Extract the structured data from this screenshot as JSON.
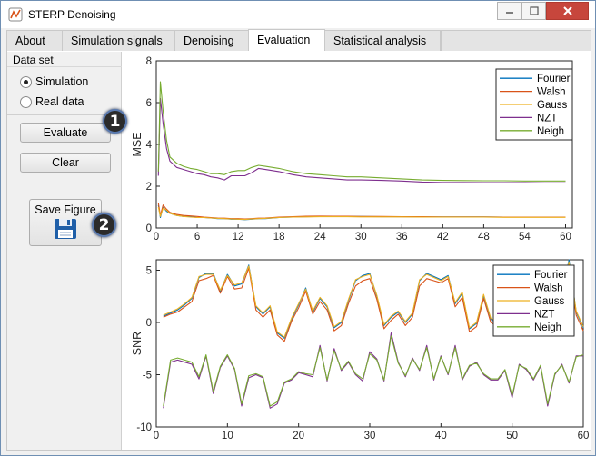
{
  "window": {
    "title": "STERP Denoising"
  },
  "tabs": [
    {
      "label": "About"
    },
    {
      "label": "Simulation signals"
    },
    {
      "label": "Denoising"
    },
    {
      "label": "Evaluation",
      "active": true
    },
    {
      "label": "Statistical analysis"
    }
  ],
  "dataset": {
    "title": "Data set",
    "options": [
      {
        "label": "Simulation",
        "selected": true
      },
      {
        "label": "Real data",
        "selected": false
      }
    ]
  },
  "buttons": {
    "evaluate": "Evaluate",
    "clear": "Clear",
    "save_figure": "Save Figure"
  },
  "badges": [
    "1",
    "2"
  ],
  "icons": [
    "app-icon",
    "minimize-icon",
    "maximize-icon",
    "close-icon",
    "floppy-disk-icon"
  ],
  "colors": {
    "Fourier": "#0072bd",
    "Walsh": "#d95319",
    "Gauss": "#edb120",
    "NZT": "#7e2f8e",
    "Neigh": "#77ac30",
    "badge": "#2b2b2b",
    "close": "#c7463c"
  },
  "chart_data": [
    {
      "type": "line",
      "title": "",
      "xlabel": "",
      "ylabel": "MSE",
      "xlim": [
        0,
        61
      ],
      "ylim": [
        0,
        8
      ],
      "xticks": [
        0,
        6,
        12,
        18,
        24,
        30,
        36,
        42,
        48,
        54,
        60
      ],
      "yticks": [
        0,
        2,
        4,
        6,
        8
      ],
      "legend_position": "top-right",
      "grid": false,
      "x": [
        0.3,
        0.6,
        1,
        1.5,
        2,
        3,
        4,
        5,
        6,
        7,
        8,
        9,
        10,
        11,
        12,
        13,
        14,
        15,
        16,
        18,
        20,
        22,
        24,
        26,
        28,
        30,
        33,
        36,
        39,
        42,
        45,
        48,
        51,
        54,
        57,
        60
      ],
      "series": [
        {
          "name": "Fourier",
          "values": [
            1.1,
            0.5,
            1.0,
            0.8,
            0.7,
            0.6,
            0.55,
            0.55,
            0.5,
            0.5,
            0.48,
            0.45,
            0.45,
            0.42,
            0.42,
            0.4,
            0.42,
            0.45,
            0.45,
            0.5,
            0.52,
            0.54,
            0.55,
            0.55,
            0.55,
            0.55,
            0.54,
            0.54,
            0.53,
            0.53,
            0.53,
            0.53,
            0.52,
            0.52,
            0.52,
            0.52
          ]
        },
        {
          "name": "Walsh",
          "values": [
            1.2,
            0.6,
            1.1,
            0.9,
            0.75,
            0.65,
            0.6,
            0.58,
            0.55,
            0.52,
            0.5,
            0.48,
            0.47,
            0.45,
            0.45,
            0.43,
            0.45,
            0.47,
            0.48,
            0.52,
            0.54,
            0.56,
            0.57,
            0.56,
            0.56,
            0.55,
            0.55,
            0.54,
            0.54,
            0.53,
            0.53,
            0.53,
            0.52,
            0.52,
            0.52,
            0.52
          ]
        },
        {
          "name": "Gauss",
          "values": [
            1.0,
            0.55,
            0.95,
            0.85,
            0.7,
            0.6,
            0.55,
            0.52,
            0.5,
            0.5,
            0.48,
            0.46,
            0.45,
            0.43,
            0.42,
            0.41,
            0.43,
            0.45,
            0.46,
            0.5,
            0.52,
            0.53,
            0.54,
            0.54,
            0.54,
            0.53,
            0.53,
            0.53,
            0.52,
            0.52,
            0.52,
            0.52,
            0.51,
            0.51,
            0.51,
            0.51
          ]
        },
        {
          "name": "NZT",
          "values": [
            2.5,
            6.2,
            5.0,
            3.8,
            3.2,
            2.9,
            2.8,
            2.7,
            2.6,
            2.55,
            2.45,
            2.4,
            2.3,
            2.5,
            2.5,
            2.5,
            2.65,
            2.85,
            2.8,
            2.7,
            2.55,
            2.45,
            2.4,
            2.35,
            2.3,
            2.3,
            2.28,
            2.25,
            2.2,
            2.18,
            2.18,
            2.17,
            2.17,
            2.17,
            2.16,
            2.16
          ]
        },
        {
          "name": "Neigh",
          "values": [
            2.7,
            7.0,
            5.6,
            4.2,
            3.4,
            3.1,
            2.95,
            2.85,
            2.8,
            2.7,
            2.6,
            2.6,
            2.55,
            2.7,
            2.75,
            2.75,
            2.9,
            3.0,
            2.95,
            2.85,
            2.7,
            2.6,
            2.55,
            2.5,
            2.45,
            2.45,
            2.4,
            2.35,
            2.3,
            2.28,
            2.27,
            2.26,
            2.26,
            2.25,
            2.25,
            2.25
          ]
        }
      ]
    },
    {
      "type": "line",
      "title": "",
      "xlabel": "",
      "ylabel": "SNR",
      "xlim": [
        0,
        60
      ],
      "ylim": [
        -10,
        6
      ],
      "xticks": [
        0,
        10,
        20,
        30,
        40,
        50,
        60
      ],
      "yticks": [
        -10,
        -5,
        0,
        5
      ],
      "legend_position": "top-right",
      "grid": false,
      "x": [
        1,
        2,
        3,
        4,
        5,
        6,
        7,
        8,
        9,
        10,
        11,
        12,
        13,
        14,
        15,
        16,
        17,
        18,
        19,
        20,
        21,
        22,
        23,
        24,
        25,
        26,
        27,
        28,
        29,
        30,
        31,
        32,
        33,
        34,
        35,
        36,
        37,
        38,
        39,
        40,
        41,
        42,
        43,
        44,
        45,
        46,
        47,
        48,
        49,
        50,
        51,
        52,
        53,
        54,
        55,
        56,
        57,
        58,
        59,
        60
      ],
      "series": [
        {
          "name": "Fourier",
          "values": [
            0.6,
            0.9,
            1.2,
            1.7,
            2.3,
            4.3,
            4.7,
            4.7,
            3.0,
            4.6,
            3.5,
            3.7,
            5.5,
            1.5,
            0.8,
            1.5,
            -1.0,
            -1.5,
            0.3,
            1.7,
            3.3,
            1.0,
            2.3,
            1.5,
            -0.5,
            0,
            2.1,
            4.0,
            4.5,
            4.7,
            2.5,
            -0.3,
            0.5,
            1.0,
            0,
            0.8,
            4.0,
            4.7,
            4.4,
            4.1,
            4.5,
            1.8,
            2.8,
            -0.6,
            -0.1,
            2.6,
            0.3,
            -0.1,
            -1.0,
            0.8,
            1.0,
            -0.5,
            2.5,
            1.5,
            4.2,
            1.2,
            2.6,
            6.0,
            1.0,
            -0.5
          ]
        },
        {
          "name": "Walsh",
          "values": [
            0.5,
            0.8,
            1.0,
            1.5,
            2.0,
            4.0,
            4.2,
            4.5,
            2.8,
            4.4,
            3.2,
            3.3,
            5.2,
            1.2,
            0.5,
            1.2,
            -1.2,
            -1.8,
            0.1,
            1.4,
            3.0,
            0.8,
            2.0,
            1.2,
            -0.8,
            -0.3,
            1.8,
            3.5,
            4.0,
            4.2,
            2.2,
            -0.6,
            0.2,
            0.8,
            -0.3,
            0.5,
            3.5,
            4.2,
            4.0,
            3.8,
            4.2,
            1.5,
            2.4,
            -0.9,
            -0.4,
            2.3,
            0,
            -0.4,
            -1.3,
            0.5,
            0.7,
            -0.8,
            2.2,
            1.2,
            3.8,
            1.0,
            2.3,
            5.5,
            0.7,
            -0.8
          ]
        },
        {
          "name": "Gauss",
          "values": [
            0.7,
            1.0,
            1.3,
            1.8,
            2.4,
            4.4,
            4.6,
            4.6,
            3.1,
            4.5,
            3.6,
            3.8,
            5.4,
            1.6,
            0.9,
            1.6,
            -0.9,
            -1.4,
            0.4,
            1.8,
            3.2,
            1.1,
            2.4,
            1.6,
            -0.4,
            0.1,
            2.2,
            4.1,
            4.4,
            4.6,
            2.6,
            -0.2,
            0.6,
            1.1,
            0.1,
            0.9,
            4.1,
            4.6,
            4.3,
            4.0,
            4.4,
            1.9,
            2.9,
            -0.5,
            0,
            2.7,
            0.4,
            0,
            -0.9,
            0.9,
            1.1,
            -0.4,
            2.6,
            1.6,
            4.3,
            1.3,
            2.7,
            5.8,
            1.1,
            -0.4
          ]
        },
        {
          "name": "NZT",
          "values": [
            -8.2,
            -3.8,
            -3.6,
            -3.8,
            -4.0,
            -5.4,
            -3.2,
            -6.8,
            -4.3,
            -3.2,
            -4.5,
            -8.0,
            -5.3,
            -5.0,
            -5.3,
            -8.2,
            -7.8,
            -5.8,
            -5.5,
            -4.8,
            -5.0,
            -5.2,
            -2.2,
            -5.6,
            -2.5,
            -4.6,
            -3.8,
            -5.0,
            -5.6,
            -2.8,
            -3.5,
            -5.6,
            -1.0,
            -3.8,
            -5.2,
            -3.4,
            -4.6,
            -2.2,
            -5.5,
            -3.2,
            -5.0,
            -2.2,
            -5.5,
            -4.2,
            -3.8,
            -5.0,
            -5.5,
            -5.5,
            -4.6,
            -7.2,
            -4.0,
            -4.5,
            -5.5,
            -4.2,
            -8.0,
            -5.0,
            -4.0,
            -5.8,
            -3.2,
            -3.2
          ]
        },
        {
          "name": "Neigh",
          "values": [
            -8.0,
            -3.6,
            -3.4,
            -3.6,
            -3.8,
            -5.2,
            -3.1,
            -6.6,
            -4.2,
            -3.1,
            -4.4,
            -7.8,
            -5.1,
            -4.9,
            -5.2,
            -8.0,
            -7.6,
            -5.7,
            -5.4,
            -4.7,
            -4.9,
            -5.0,
            -2.4,
            -5.5,
            -2.7,
            -4.5,
            -3.7,
            -4.9,
            -5.4,
            -3.0,
            -3.6,
            -5.5,
            -1.3,
            -3.9,
            -5.1,
            -3.5,
            -4.5,
            -2.4,
            -5.4,
            -3.3,
            -4.9,
            -2.4,
            -5.4,
            -4.1,
            -3.9,
            -4.9,
            -5.4,
            -5.4,
            -4.5,
            -7.0,
            -4.1,
            -4.4,
            -5.4,
            -4.1,
            -7.8,
            -4.9,
            -4.1,
            -5.7,
            -3.3,
            -3.1
          ]
        }
      ]
    }
  ]
}
